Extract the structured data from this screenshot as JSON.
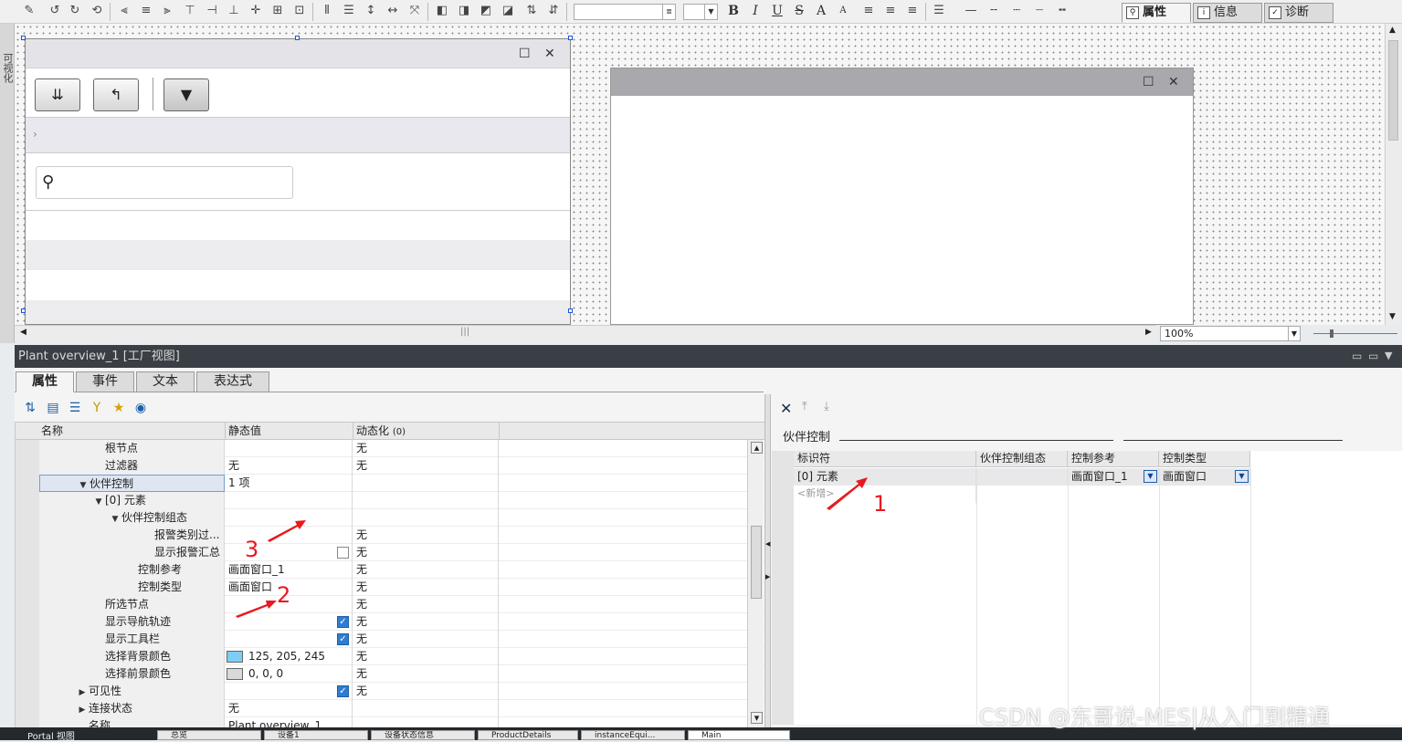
{
  "toolbar": {
    "zoom_field": ""
  },
  "canvas": {
    "zoom": "100%",
    "left_strip_label": "可视化"
  },
  "panel_header": {
    "title": "Plant overview_1 [工厂视图]",
    "tabs": [
      {
        "label": "属性",
        "icon": "properties-icon"
      },
      {
        "label": "信息",
        "icon": "info-icon"
      },
      {
        "label": "诊断",
        "icon": "diagnostics-icon"
      }
    ]
  },
  "property_tabs": [
    "属性",
    "事件",
    "文本",
    "表达式"
  ],
  "grid": {
    "headers": {
      "name": "名称",
      "static": "静态值",
      "dynamic": "动态化",
      "dynamic_count": "(0)"
    },
    "rows": [
      {
        "indent": 3,
        "expander": "",
        "name": "根节点",
        "static": "",
        "dynamic": "无"
      },
      {
        "indent": 3,
        "expander": "",
        "name": "过滤器",
        "static": "无",
        "dynamic": "无"
      },
      {
        "indent": 2,
        "expander": "▼",
        "name": "伙伴控制",
        "static": "1 项",
        "dynamic": "",
        "selected": true
      },
      {
        "indent": 3,
        "expander": "▼",
        "name": "[0] 元素",
        "static": "",
        "dynamic": ""
      },
      {
        "indent": 4,
        "expander": "▼",
        "name": "伙伴控制组态",
        "static": "",
        "dynamic": ""
      },
      {
        "indent": 6,
        "expander": "",
        "name": "报警类别过...",
        "static": "",
        "dynamic": "无"
      },
      {
        "indent": 6,
        "expander": "",
        "name": "显示报警汇总",
        "static": "",
        "dynamic": "无",
        "checkbox": false
      },
      {
        "indent": 5,
        "expander": "",
        "name": "控制参考",
        "static": "画面窗口_1",
        "dynamic": "无"
      },
      {
        "indent": 5,
        "expander": "",
        "name": "控制类型",
        "static": "画面窗口",
        "dynamic": "无"
      },
      {
        "indent": 3,
        "expander": "",
        "name": "所选节点",
        "static": "",
        "dynamic": "无"
      },
      {
        "indent": 3,
        "expander": "",
        "name": "显示导航轨迹",
        "static": "",
        "dynamic": "无",
        "checkbox": true
      },
      {
        "indent": 3,
        "expander": "",
        "name": "显示工具栏",
        "static": "",
        "dynamic": "无",
        "checkbox": true
      },
      {
        "indent": 3,
        "expander": "",
        "name": "选择背景颜色",
        "static": "125, 205, 245",
        "dynamic": "无",
        "swatch": "#7dcdf5"
      },
      {
        "indent": 3,
        "expander": "",
        "name": "选择前景颜色",
        "static": "0, 0, 0",
        "dynamic": "无",
        "swatch": "#d9d9d9"
      },
      {
        "indent": 2,
        "expander": "▶",
        "name": "可见性",
        "static": "",
        "dynamic": "无",
        "checkbox": true
      },
      {
        "indent": 2,
        "expander": "▶",
        "name": "连接状态",
        "static": "无",
        "dynamic": ""
      },
      {
        "indent": 2,
        "expander": "",
        "name": "名称",
        "static": "Plant overview_1",
        "dynamic": ""
      }
    ]
  },
  "right_panel": {
    "section_title": "伙伴控制",
    "headers": [
      "标识符",
      "伙伴控制组态",
      "控制参考",
      "控制类型"
    ],
    "rows": [
      {
        "id": "[0] 元素",
        "config": "",
        "ref": "画面窗口_1",
        "type": "画面窗口"
      }
    ],
    "add_new": "<新增>"
  },
  "annotations": [
    "1",
    "2",
    "3"
  ],
  "taskbar": [
    "Portal 视图",
    "总览",
    "设备1",
    "设备状态信息",
    "ProductDetails",
    "instanceEqui...",
    "Main"
  ],
  "watermark": "CSDN @东哥说-MES|从入门到精通",
  "colors": {
    "header_bg": "#3a3f45",
    "checkbox_on": "#2f7dd1",
    "annotation": "#e8191f"
  }
}
